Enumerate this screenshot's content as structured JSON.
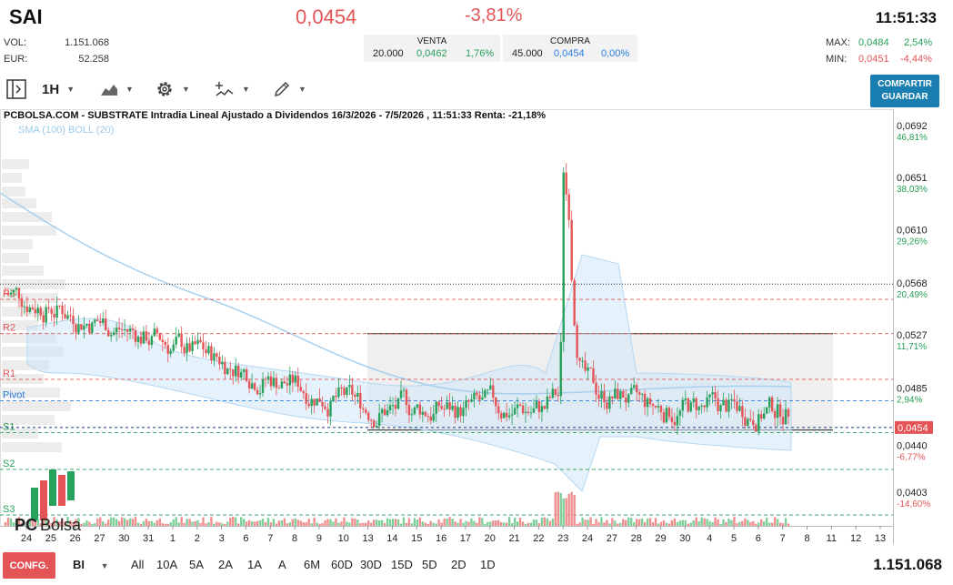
{
  "header": {
    "ticker": "SAI",
    "price": "0,0454",
    "change": "-3,81%",
    "time": "11:51:33",
    "vol_label": "VOL:",
    "vol_value": "1.151.068",
    "eur_label": "EUR:",
    "eur_value": "52.258",
    "venta_label": "VENTA",
    "venta_qty": "20.000",
    "venta_price": "0,0462",
    "venta_pct": "1,76%",
    "compra_label": "COMPRA",
    "compra_qty": "45.000",
    "compra_price": "0,0454",
    "compra_pct": "0,00%",
    "max_label": "MAX:",
    "max_value": "0,0484",
    "max_pct": "2,54%",
    "min_label": "MIN:",
    "min_value": "0,0451",
    "min_pct": "-4,44%"
  },
  "toolbar": {
    "interval": "1H",
    "share_line1": "COMPARTIR",
    "share_line2": "GUARDAR"
  },
  "chart": {
    "title": "PCBOLSA.COM - SUBSTRATE Intradia Lineal Ajustado a Dividendos 16/3/2026 - 7/5/2026 , 11:51:33 Renta: -21,18%",
    "indicators": "SMA (100) BOLL (20)",
    "logo_pc": "PC",
    "logo_bolsa": "Bolsa",
    "current_price_tag": "0,0454",
    "price_axis": [
      {
        "price": "0,0692",
        "pct": "46,81%",
        "dir": "up"
      },
      {
        "price": "0,0651",
        "pct": "38,03%",
        "dir": "up"
      },
      {
        "price": "0,0610",
        "pct": "29,26%",
        "dir": "up"
      },
      {
        "price": "0,0568",
        "pct": "20,49%",
        "dir": "up"
      },
      {
        "price": "0,0527",
        "pct": "11,71%",
        "dir": "up"
      },
      {
        "price": "0,0485",
        "pct": "2,94%",
        "dir": "up"
      },
      {
        "price": "0,0440",
        "pct": "-6,77%",
        "dir": "down"
      },
      {
        "price": "0,0403",
        "pct": "-14,60%",
        "dir": "down"
      }
    ],
    "pivot_levels": [
      {
        "label": "R3",
        "value": 0.0555,
        "color": "#e45456"
      },
      {
        "label": "R2",
        "value": 0.0528,
        "color": "#e45456"
      },
      {
        "label": "R1",
        "value": 0.0492,
        "color": "#e45456"
      },
      {
        "label": "Pivot",
        "value": 0.0475,
        "color": "#2a7de1"
      },
      {
        "label": "S1",
        "value": 0.045,
        "color": "#26a05a"
      },
      {
        "label": "S2",
        "value": 0.0421,
        "color": "#26a05a"
      },
      {
        "label": "S3",
        "value": 0.0385,
        "color": "#26a05a"
      }
    ],
    "x_labels": [
      "24",
      "25",
      "26",
      "27",
      "30",
      "31",
      "1",
      "2",
      "3",
      "6",
      "7",
      "8",
      "9",
      "10",
      "13",
      "14",
      "15",
      "16",
      "17",
      "20",
      "21",
      "22",
      "23",
      "24",
      "27",
      "28",
      "29",
      "30",
      "4",
      "5",
      "6",
      "7",
      "8",
      "11",
      "12",
      "13"
    ]
  },
  "bottom": {
    "config_label": "CONFG.",
    "chart_type": "BI",
    "ranges": [
      "All",
      "10A",
      "5A",
      "2A",
      "1A",
      "A",
      "6M",
      "60D",
      "30D",
      "15D",
      "5D",
      "2D",
      "1D"
    ],
    "volume_total": "1.151.068"
  }
}
